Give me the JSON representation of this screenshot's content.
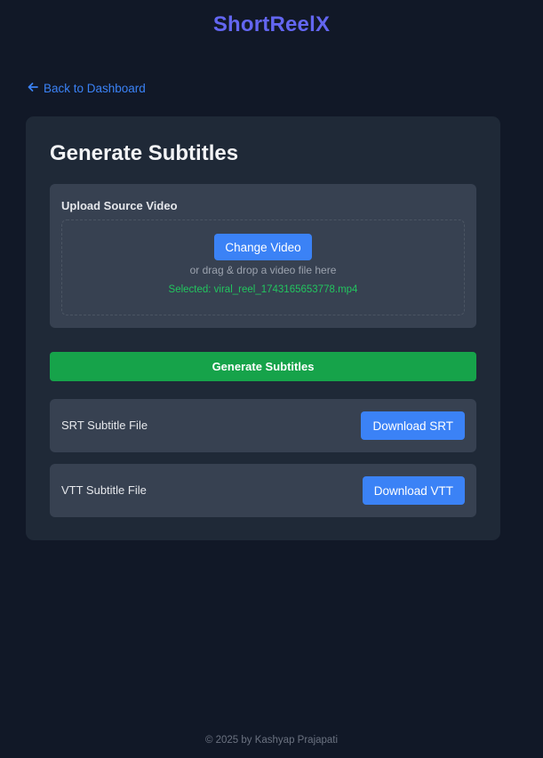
{
  "header": {
    "brand": "ShortReelX"
  },
  "nav": {
    "back_label": "Back to Dashboard"
  },
  "card": {
    "title": "Generate Subtitles",
    "upload": {
      "label": "Upload Source Video",
      "change_button": "Change Video",
      "hint": "or drag & drop a video file here",
      "selected": "Selected: viral_reel_1743165653778.mp4"
    },
    "generate_button": "Generate Subtitles",
    "files": [
      {
        "label": "SRT Subtitle File",
        "button": "Download SRT"
      },
      {
        "label": "VTT Subtitle File",
        "button": "Download VTT"
      }
    ]
  },
  "footer": {
    "text": "© 2025 by Kashyap Prajapati"
  },
  "colors": {
    "background": "#111827",
    "card": "#1f2937",
    "panel": "#374151",
    "brand": "#6366f1",
    "primary": "#3b82f6",
    "success": "#16a34a",
    "selected_text": "#22c55e"
  },
  "icons": {
    "back": "arrow-left-icon"
  }
}
